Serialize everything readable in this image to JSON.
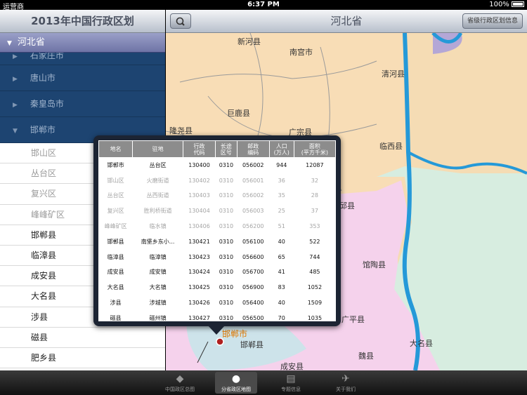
{
  "status": {
    "carrier": "运营商",
    "time": "6:37 PM",
    "battery": "100%"
  },
  "left": {
    "title": "2013年中国行政区划",
    "province": "河北省",
    "cities": [
      {
        "label": "石家庄市"
      },
      {
        "label": "唐山市"
      },
      {
        "label": "秦皇岛市"
      },
      {
        "label": "邯郸市"
      }
    ],
    "counties": [
      {
        "label": "邯山区",
        "dim": true
      },
      {
        "label": "丛台区",
        "dim": true
      },
      {
        "label": "复兴区",
        "dim": true
      },
      {
        "label": "峰峰矿区",
        "dim": true
      },
      {
        "label": "邯郸县",
        "dim": false
      },
      {
        "label": "临漳县",
        "dim": false
      },
      {
        "label": "成安县",
        "dim": false
      },
      {
        "label": "大名县",
        "dim": false
      },
      {
        "label": "涉县",
        "dim": false
      },
      {
        "label": "磁县",
        "dim": false
      },
      {
        "label": "肥乡县",
        "dim": false
      }
    ]
  },
  "right": {
    "title": "河北省",
    "info_button": "省级行政区划信息",
    "map_labels": [
      {
        "text": "新河县"
      },
      {
        "text": "南宫市"
      },
      {
        "text": "清河县"
      },
      {
        "text": "巨鹿县"
      },
      {
        "text": "隆尧县"
      },
      {
        "text": "广宗县"
      },
      {
        "text": "临西县"
      },
      {
        "text": "邱县"
      },
      {
        "text": "馆陶县"
      },
      {
        "text": "广平县"
      },
      {
        "text": "邯郸市"
      },
      {
        "text": "邯郸县"
      },
      {
        "text": "大名县"
      },
      {
        "text": "魏县"
      },
      {
        "text": "成安县"
      }
    ]
  },
  "table": {
    "headers": [
      "地名",
      "驻地",
      "行政\n代码",
      "长途\n区号",
      "邮政\n编码",
      "人口\n(万人)",
      "面积\n(平方千米)"
    ],
    "rows": [
      {
        "cells": [
          "邯郸市",
          "丛台区",
          "130400",
          "0310",
          "056002",
          "944",
          "12087"
        ],
        "dim": false
      },
      {
        "cells": [
          "邯山区",
          "火磨街道",
          "130402",
          "0310",
          "056001",
          "36",
          "32"
        ],
        "dim": true
      },
      {
        "cells": [
          "丛台区",
          "丛西街道",
          "130403",
          "0310",
          "056002",
          "35",
          "28"
        ],
        "dim": true
      },
      {
        "cells": [
          "复兴区",
          "胜利桥街道",
          "130404",
          "0310",
          "056003",
          "25",
          "37"
        ],
        "dim": true
      },
      {
        "cells": [
          "峰峰矿区",
          "临水镇",
          "130406",
          "0310",
          "056200",
          "51",
          "353"
        ],
        "dim": true
      },
      {
        "cells": [
          "邯郸县",
          "南堡乡东小...",
          "130421",
          "0310",
          "056100",
          "40",
          "522"
        ],
        "dim": false
      },
      {
        "cells": [
          "临漳县",
          "临漳镇",
          "130423",
          "0310",
          "056600",
          "65",
          "744"
        ],
        "dim": false
      },
      {
        "cells": [
          "成安县",
          "成安镇",
          "130424",
          "0310",
          "056700",
          "41",
          "485"
        ],
        "dim": false
      },
      {
        "cells": [
          "大名县",
          "大名镇",
          "130425",
          "0310",
          "056900",
          "83",
          "1052"
        ],
        "dim": false
      },
      {
        "cells": [
          "涉县",
          "涉城镇",
          "130426",
          "0310",
          "056400",
          "40",
          "1509"
        ],
        "dim": false
      },
      {
        "cells": [
          "磁县",
          "磁州镇",
          "130427",
          "0310",
          "056500",
          "70",
          "1035"
        ],
        "dim": false
      }
    ]
  },
  "tabs": [
    {
      "label": "中国政区总图",
      "icon": "china-map-icon",
      "active": false
    },
    {
      "label": "分省政区地图",
      "icon": "globe-icon",
      "active": true
    },
    {
      "label": "专题信息",
      "icon": "document-icon",
      "active": false
    },
    {
      "label": "关于我们",
      "icon": "bird-icon",
      "active": false
    }
  ]
}
